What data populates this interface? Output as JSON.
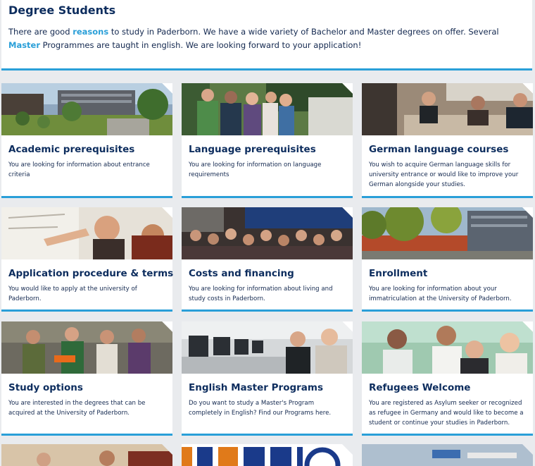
{
  "intro": {
    "title": "Degree Students",
    "text1": "There are good ",
    "link1": "reasons",
    "text2": " to study in Paderborn. We have a wide variety of Bachelor and Master degrees on offer. Several ",
    "link2": "Master",
    "text3": " Programmes are taught in english. We are looking forward to your application!"
  },
  "cards": [
    {
      "title": "Academic prerequisites",
      "text": "You are looking for information about entrance criteria",
      "image": "campus-buildings-photo"
    },
    {
      "title": "Language prerequisites",
      "text": "You are looking for information on language requirements",
      "image": "students-group-photo"
    },
    {
      "title": "German language courses",
      "text": "You wish to acquire German language skills for university entrance or would like to improve your German alongside your studies.",
      "image": "classroom-photo"
    },
    {
      "title": "Application procedure & terms",
      "text": "You would like to apply at the university of Paderborn.",
      "image": "students-whiteboard-photo"
    },
    {
      "title": "Costs and financing",
      "text": "You are looking for information about living and study costs in Paderborn.",
      "image": "students-crowd-photo"
    },
    {
      "title": "Enrollment",
      "text": "You are looking for information about your immatriculation at the University of Paderborn.",
      "image": "campus-trees-photo"
    },
    {
      "title": "Study options",
      "text": "You are interested in the degrees that can be acquired at the University of Paderborn.",
      "image": "students-outdoors-photo"
    },
    {
      "title": "English Master Programs",
      "text": "Do you want to study a Master's Program completely in English? Find our Programs here.",
      "image": "computer-lab-photo"
    },
    {
      "title": "Refugees Welcome",
      "text": "You are registered as Asylum seeker or recognized as refugee in Germany and would like to become a student or continue your studies in Paderborn.",
      "image": "smiling-students-photo"
    }
  ],
  "colors": {
    "accent": "#2a9fd8",
    "heading": "#0d2d5e",
    "text": "#13284f"
  }
}
